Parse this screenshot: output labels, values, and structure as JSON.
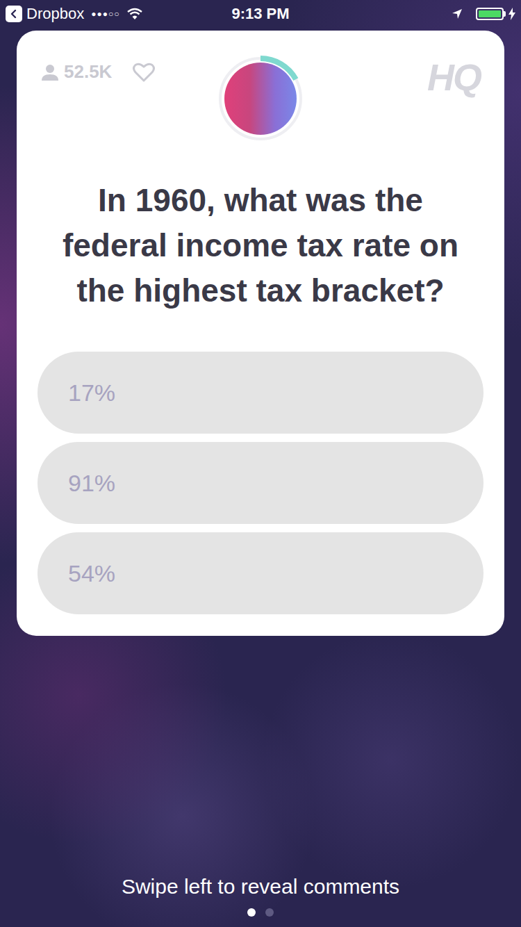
{
  "status_bar": {
    "back_label": "Dropbox",
    "signal": "●●●○○",
    "time": "9:13 PM",
    "battery": {
      "level": 1,
      "charging": true
    }
  },
  "viewers": "52.5K",
  "liked": false,
  "logo": "HQ",
  "timer": {
    "level": 0.17
  },
  "question": "In 1960, what was the federal income tax rate on the highest tax bracket?",
  "options": [
    {
      "label": "17%",
      "selected": false
    },
    {
      "label": "91%",
      "selected": false
    },
    {
      "label": "54%",
      "selected": false
    }
  ],
  "hint": "Swipe left to reveal comments",
  "pages": [
    {
      "selected": true
    },
    {
      "selected": false
    }
  ]
}
